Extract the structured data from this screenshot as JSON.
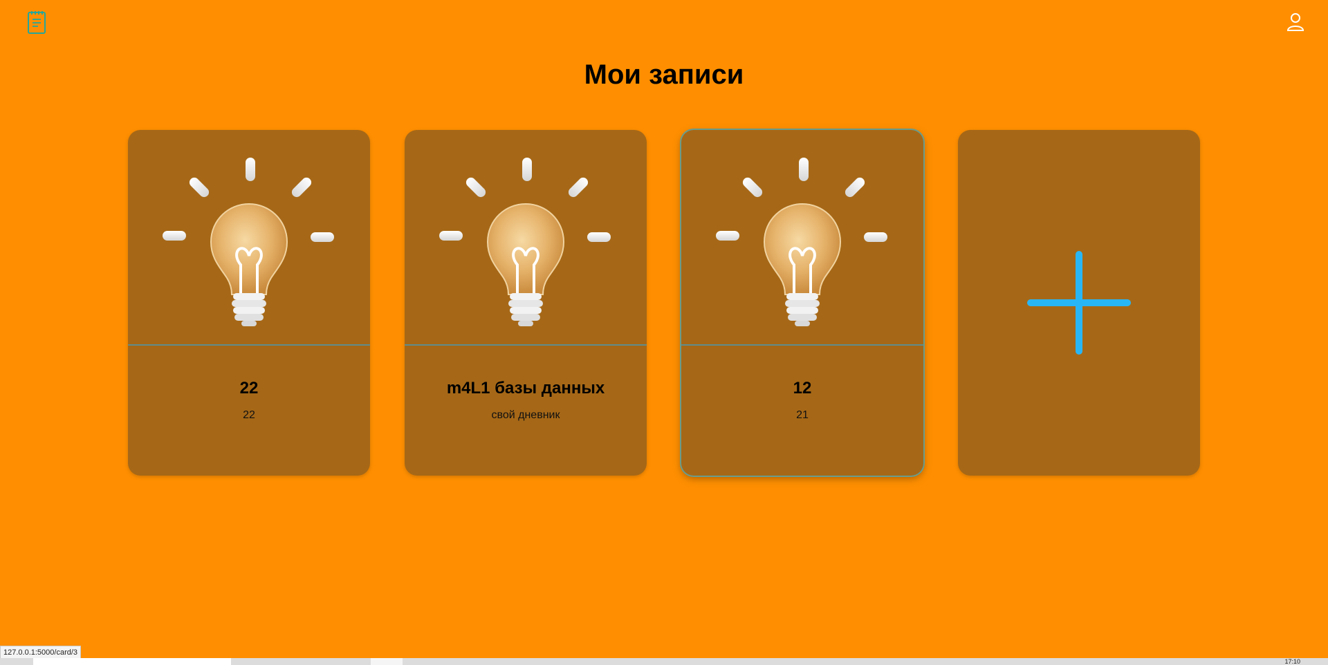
{
  "header": {
    "notes_icon": "notes-icon",
    "user_icon": "user-icon",
    "title": "Мои записи"
  },
  "cards": [
    {
      "title": "22",
      "text": "22",
      "image": "lightbulb-image"
    },
    {
      "title": "m4L1 базы данных",
      "text": "свой дневник",
      "image": "lightbulb-image"
    },
    {
      "title": "12",
      "text": "21",
      "image": "lightbulb-image"
    }
  ],
  "add_card": {
    "icon": "plus-icon"
  },
  "status_bar": {
    "url": "127.0.0.1:5000/card/3"
  },
  "taskbar": {
    "clock": "17:10"
  },
  "colors": {
    "background": "#FF8F00",
    "card": "#A66817",
    "accent": "#29B6F6",
    "icon": "#26A69A"
  }
}
